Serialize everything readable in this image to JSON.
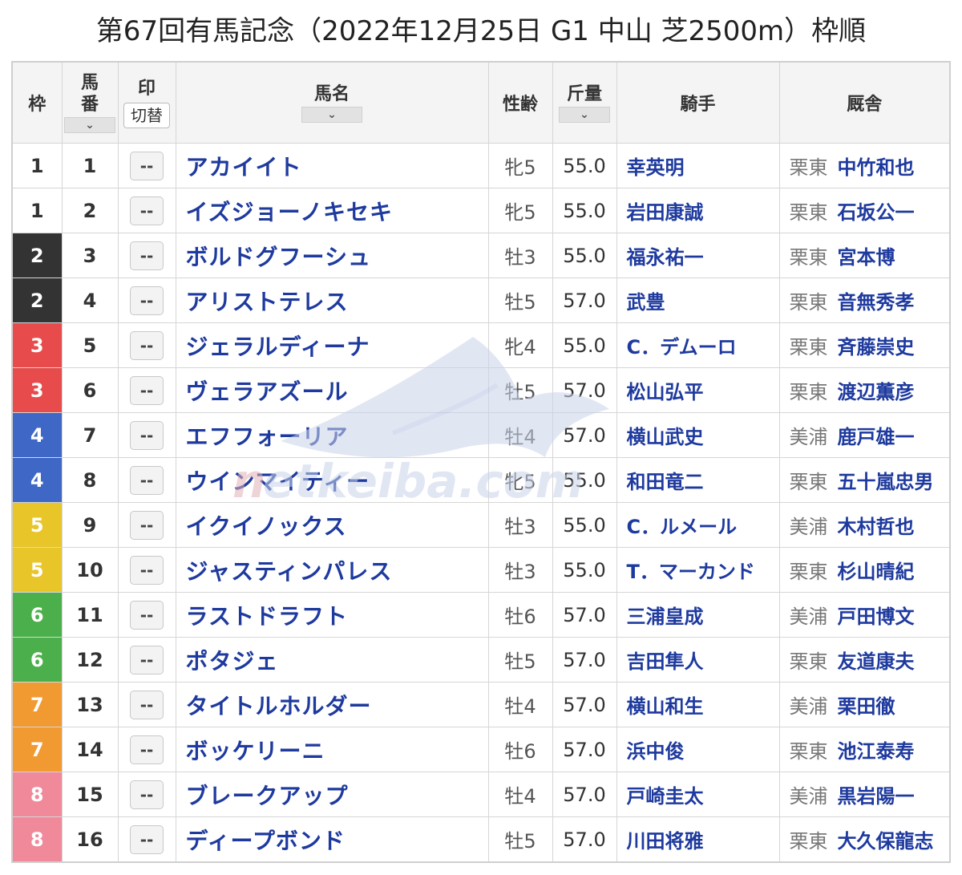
{
  "page": {
    "title": "第67回有馬記念（2022年12月25日 G1 中山 芝2500m）枠順"
  },
  "headers": {
    "waku": "枠",
    "umaban_top": "馬",
    "umaban_bottom": "番",
    "mark": "印",
    "mark_toggle": "切替",
    "horse": "馬名",
    "sex_age": "性齢",
    "weight": "斤量",
    "jockey": "騎手",
    "stable": "厩舎",
    "sort_glyph": "⌄"
  },
  "watermark": {
    "text": "netkeiba.com"
  },
  "waku_colors": {
    "1": {
      "bg": "#ffffff",
      "fg": "#333333"
    },
    "2": {
      "bg": "#333333",
      "fg": "#ffffff"
    },
    "3": {
      "bg": "#e84b4b",
      "fg": "#ffffff"
    },
    "4": {
      "bg": "#3f67c5",
      "fg": "#ffffff"
    },
    "5": {
      "bg": "#e8c62a",
      "fg": "#ffffff"
    },
    "6": {
      "bg": "#4bb04b",
      "fg": "#ffffff"
    },
    "7": {
      "bg": "#f19a32",
      "fg": "#ffffff"
    },
    "8": {
      "bg": "#f0899a",
      "fg": "#ffffff"
    }
  },
  "rows": [
    {
      "waku": "1",
      "umaban": "1",
      "mark": "--",
      "horse": "アカイイト",
      "sex_age": "牝5",
      "weight": "55.0",
      "jockey": "幸英明",
      "region": "栗東",
      "trainer": "中竹和也"
    },
    {
      "waku": "1",
      "umaban": "2",
      "mark": "--",
      "horse": "イズジョーノキセキ",
      "sex_age": "牝5",
      "weight": "55.0",
      "jockey": "岩田康誠",
      "region": "栗東",
      "trainer": "石坂公一"
    },
    {
      "waku": "2",
      "umaban": "3",
      "mark": "--",
      "horse": "ボルドグフーシュ",
      "sex_age": "牡3",
      "weight": "55.0",
      "jockey": "福永祐一",
      "region": "栗東",
      "trainer": "宮本博"
    },
    {
      "waku": "2",
      "umaban": "4",
      "mark": "--",
      "horse": "アリストテレス",
      "sex_age": "牡5",
      "weight": "57.0",
      "jockey": "武豊",
      "region": "栗東",
      "trainer": "音無秀孝"
    },
    {
      "waku": "3",
      "umaban": "5",
      "mark": "--",
      "horse": "ジェラルディーナ",
      "sex_age": "牝4",
      "weight": "55.0",
      "jockey": "C．デムーロ",
      "region": "栗東",
      "trainer": "斉藤崇史"
    },
    {
      "waku": "3",
      "umaban": "6",
      "mark": "--",
      "horse": "ヴェラアズール",
      "sex_age": "牡5",
      "weight": "57.0",
      "jockey": "松山弘平",
      "region": "栗東",
      "trainer": "渡辺薫彦"
    },
    {
      "waku": "4",
      "umaban": "7",
      "mark": "--",
      "horse": "エフフォーリア",
      "sex_age": "牡4",
      "weight": "57.0",
      "jockey": "横山武史",
      "region": "美浦",
      "trainer": "鹿戸雄一"
    },
    {
      "waku": "4",
      "umaban": "8",
      "mark": "--",
      "horse": "ウインマイティー",
      "sex_age": "牝5",
      "weight": "55.0",
      "jockey": "和田竜二",
      "region": "栗東",
      "trainer": "五十嵐忠男"
    },
    {
      "waku": "5",
      "umaban": "9",
      "mark": "--",
      "horse": "イクイノックス",
      "sex_age": "牡3",
      "weight": "55.0",
      "jockey": "C．ルメール",
      "region": "美浦",
      "trainer": "木村哲也"
    },
    {
      "waku": "5",
      "umaban": "10",
      "mark": "--",
      "horse": "ジャスティンパレス",
      "sex_age": "牡3",
      "weight": "55.0",
      "jockey": "T．マーカンド",
      "region": "栗東",
      "trainer": "杉山晴紀"
    },
    {
      "waku": "6",
      "umaban": "11",
      "mark": "--",
      "horse": "ラストドラフト",
      "sex_age": "牡6",
      "weight": "57.0",
      "jockey": "三浦皇成",
      "region": "美浦",
      "trainer": "戸田博文"
    },
    {
      "waku": "6",
      "umaban": "12",
      "mark": "--",
      "horse": "ポタジェ",
      "sex_age": "牡5",
      "weight": "57.0",
      "jockey": "吉田隼人",
      "region": "栗東",
      "trainer": "友道康夫"
    },
    {
      "waku": "7",
      "umaban": "13",
      "mark": "--",
      "horse": "タイトルホルダー",
      "sex_age": "牡4",
      "weight": "57.0",
      "jockey": "横山和生",
      "region": "美浦",
      "trainer": "栗田徹"
    },
    {
      "waku": "7",
      "umaban": "14",
      "mark": "--",
      "horse": "ボッケリーニ",
      "sex_age": "牡6",
      "weight": "57.0",
      "jockey": "浜中俊",
      "region": "栗東",
      "trainer": "池江泰寿"
    },
    {
      "waku": "8",
      "umaban": "15",
      "mark": "--",
      "horse": "ブレークアップ",
      "sex_age": "牡4",
      "weight": "57.0",
      "jockey": "戸崎圭太",
      "region": "美浦",
      "trainer": "黒岩陽一"
    },
    {
      "waku": "8",
      "umaban": "16",
      "mark": "--",
      "horse": "ディープボンド",
      "sex_age": "牡5",
      "weight": "57.0",
      "jockey": "川田将雅",
      "region": "栗東",
      "trainer": "大久保龍志"
    }
  ]
}
